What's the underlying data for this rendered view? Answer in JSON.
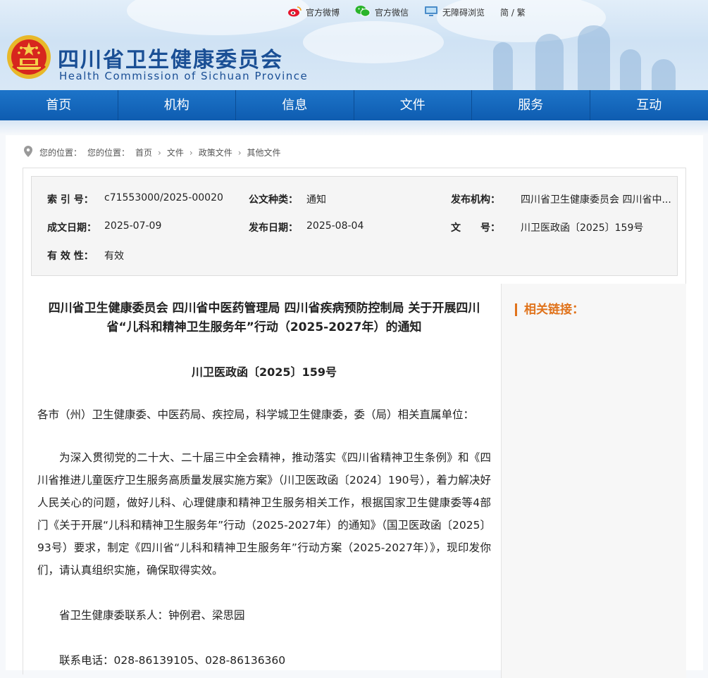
{
  "topbar": {
    "weibo_label": "官方微博",
    "wechat_label": "官方微信",
    "accessible_label": "无障碍浏览",
    "lang_label": "简 / 繁"
  },
  "header": {
    "title": "四川省卫生健康委员会",
    "subtitle": "Health Commission of Sichuan Province"
  },
  "nav": {
    "items": [
      {
        "label": "首页"
      },
      {
        "label": "机构"
      },
      {
        "label": "信息"
      },
      {
        "label": "文件"
      },
      {
        "label": "服务"
      },
      {
        "label": "互动"
      }
    ]
  },
  "breadcrumb": {
    "prefix": "您的位置：",
    "items": [
      "您的位置：",
      "首页",
      "文件",
      "政策文件",
      "其他文件"
    ]
  },
  "meta": {
    "index_label": "索 引 号：",
    "index_value": "c71553000/2025-00020",
    "type_label": "公文种类：",
    "type_value": "通知",
    "publisher_label": "发布机构：",
    "publisher_value": "四川省卫生健康委员会 四川省中...",
    "created_label": "成文日期：",
    "created_value": "2025-07-09",
    "published_label": "发布日期：",
    "published_value": "2025-08-04",
    "docno_label": "文　　号：",
    "docno_value": "川卫医政函〔2025〕159号",
    "validity_label": "有 效 性：",
    "validity_value": "有效"
  },
  "article": {
    "title": "四川省卫生健康委员会 四川省中医药管理局 四川省疾病预防控制局 关于开展四川省“儿科和精神卫生服务年”行动（2025-2027年）的通知",
    "doc_number": "川卫医政函〔2025〕159号",
    "addressee": "各市（州）卫生健康委、中医药局、疾控局，科学城卫生健康委，委（局）相关直属单位：",
    "body": "为深入贯彻党的二十大、二十届三中全会精神，推动落实《四川省精神卫生条例》和《四川省推进儿童医疗卫生服务高质量发展实施方案》（川卫医政函〔2024〕190号），着力解决好人民关心的问题，做好儿科、心理健康和精神卫生服务相关工作，根据国家卫生健康委等4部门《关于开展“儿科和精神卫生服务年”行动（2025-2027年）的通知》（国卫医政函〔2025〕93号）要求，制定《四川省“儿科和精神卫生服务年”行动方案（2025-2027年）》，现印发你们，请认真组织实施，确保取得实效。",
    "contact_person": "省卫生健康委联系人：钟例君、梁思园",
    "contact_phone": "联系电话：028-86139105、028-86136360"
  },
  "sidebar": {
    "related_title": "相关链接："
  },
  "colors": {
    "nav_blue": "#0e5cb0",
    "title_blue": "#1a4f95",
    "accent_orange": "#e0731c"
  }
}
